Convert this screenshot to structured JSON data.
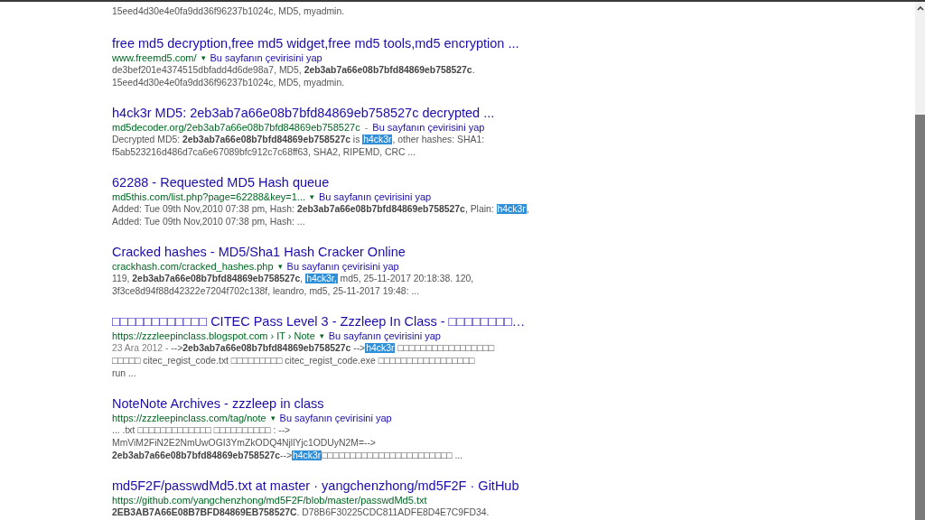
{
  "partial_result": {
    "snippet_lines": [
      [
        {
          "kind": "plain",
          "text": "15eed4d30e4e0fa9dd36f96237b1024c, MD5, myadmin."
        }
      ]
    ]
  },
  "results": [
    {
      "title": "free md5 decryption,free md5 widget,free md5 tools,md5 encryption ...",
      "url": "www.freemd5.com/",
      "menu_arrow": "▾",
      "translate": "Bu sayfanın çevirisini yap",
      "snippet_lines": [
        [
          {
            "kind": "plain",
            "text": "de3bef201e4374515dbfadd4d6de98a7, MD5, "
          },
          {
            "kind": "bold",
            "text": "2eb3ab7a66e08b7bfd84869eb758527c"
          },
          {
            "kind": "plain",
            "text": "."
          }
        ],
        [
          {
            "kind": "plain",
            "text": "15eed4d30e4e0fa9dd36f96237b1024c, MD5, myadmin."
          }
        ]
      ]
    },
    {
      "title": "h4ck3r MD5: 2eb3ab7a66e08b7bfd84869eb758527c decrypted ...",
      "url": "md5decoder.org/2eb3ab7a66e08b7bfd84869eb758527c",
      "separator": "-",
      "translate": "Bu sayfanın çevirisini yap",
      "snippet_lines": [
        [
          {
            "kind": "plain",
            "text": "Decrypted MD5: "
          },
          {
            "kind": "bold",
            "text": "2eb3ab7a66e08b7bfd84869eb758527c"
          },
          {
            "kind": "plain",
            "text": " is "
          },
          {
            "kind": "highlight",
            "text": "h4ck3r"
          },
          {
            "kind": "plain",
            "text": ", other hashes: SHA1:"
          }
        ],
        [
          {
            "kind": "plain",
            "text": "f5ab523216d486d7ca6e67089bfc912c7c68ff63, SHA2, RIPEMD, CRC ..."
          }
        ]
      ]
    },
    {
      "title": "62288 - Requested MD5 Hash queue",
      "url": "md5this.com/list.php?page=62288&key=1...",
      "menu_arrow": "▾",
      "translate": "Bu sayfanın çevirisini yap",
      "snippet_lines": [
        [
          {
            "kind": "plain",
            "text": "Added: Tue 09th Nov,2010 07:38 pm, Hash: "
          },
          {
            "kind": "bold",
            "text": "2eb3ab7a66e08b7bfd84869eb758527c"
          },
          {
            "kind": "plain",
            "text": ", Plain: "
          },
          {
            "kind": "highlight",
            "text": "h4ck3r"
          },
          {
            "kind": "plain",
            "text": ","
          }
        ],
        [
          {
            "kind": "plain",
            "text": "Added: Tue 09th Nov,2010 07:38 pm, Hash: ..."
          }
        ]
      ]
    },
    {
      "title": "Cracked hashes - MD5/Sha1 Hash Cracker Online",
      "url": "crackhash.com/cracked_hashes.php",
      "menu_arrow": "▾",
      "translate": "Bu sayfanın çevirisini yap",
      "snippet_lines": [
        [
          {
            "kind": "plain",
            "text": "119, "
          },
          {
            "kind": "bold",
            "text": "2eb3ab7a66e08b7bfd84869eb758527c"
          },
          {
            "kind": "plain",
            "text": ", "
          },
          {
            "kind": "highlight",
            "text": "h4ck3r,"
          },
          {
            "kind": "plain",
            "text": " md5, 25-11-2017 20:18:38. 120,"
          }
        ],
        [
          {
            "kind": "plain",
            "text": "3f3ce8d94f88d42322e7204f702c138f, leandro, md5, 25-11-2017 19:48: ..."
          }
        ]
      ]
    },
    {
      "title": "□□□□□□□□□□□□ CITEC Pass Level 3 - Zzzleep In Class - □□□□□□□□…",
      "url": "https://zzzleepinclass.blogspot.com › IT › Note",
      "menu_arrow": "▾",
      "translate": "Bu sayfanın çevirisini yap",
      "snippet_lines": [
        [
          {
            "kind": "date",
            "text": "23 Ara 2012 - "
          },
          {
            "kind": "plain",
            "text": "-->"
          },
          {
            "kind": "bold",
            "text": "2eb3ab7a66e08b7bfd84869eb758527c"
          },
          {
            "kind": "plain",
            "text": " -->"
          },
          {
            "kind": "highlight",
            "text": "h4ck3r"
          },
          {
            "kind": "plain",
            "text": " □□□□□□□□□□□□□□□□□"
          }
        ],
        [
          {
            "kind": "plain",
            "text": "□□□□□ citec_regist_code.txt □□□□□□□□□ citec_regist_code.exe □□□□□□□□□□□□□□□□□"
          }
        ],
        [
          {
            "kind": "plain",
            "text": "run ..."
          }
        ]
      ]
    },
    {
      "title": "NoteNote Archives - zzzleep in class",
      "url": "https://zzzleepinclass.com/tag/note",
      "menu_arrow": "▾",
      "translate": "Bu sayfanın çevirisini yap",
      "snippet_lines": [
        [
          {
            "kind": "plain",
            "text": "... .txt □□□□□□□□□□□□□ □□□□□□□□□□ : -->"
          }
        ],
        [
          {
            "kind": "plain",
            "text": "MmViM2FiN2E2NmUwOGI3YmZkODQ4NjllYjc1ODUyN2M=-->"
          }
        ],
        [
          {
            "kind": "bold",
            "text": "2eb3ab7a66e08b7bfd84869eb758527c"
          },
          {
            "kind": "plain",
            "text": "-->"
          },
          {
            "kind": "highlight",
            "text": "h4ck3r"
          },
          {
            "kind": "plain",
            "text": "□□□□□□□□□□□□□□□□□□□□□□□ ..."
          }
        ]
      ]
    },
    {
      "title": "md5F2F/passwdMd5.txt at master · yangchenzhong/md5F2F · GitHub",
      "url": "https://github.com/yangchenzhong/md5F2F/blob/master/passwdMd5.txt",
      "snippet_lines": [
        [
          {
            "kind": "bold",
            "text": "2EB3AB7A66E08B7BFD84869EB758527C"
          },
          {
            "kind": "plain",
            "text": ". D78B6F30225CDC811ADFE8D4E7C9FD34."
          }
        ]
      ]
    }
  ]
}
